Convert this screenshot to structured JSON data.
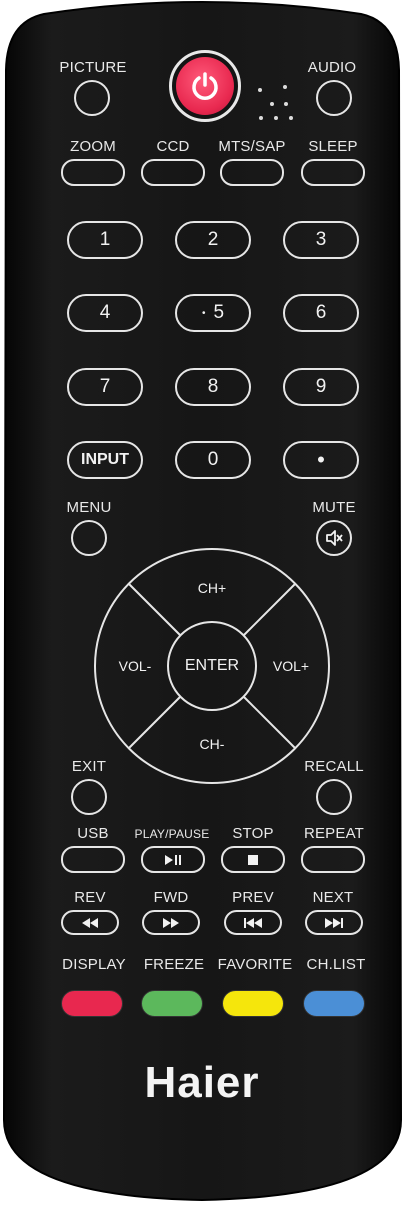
{
  "labels": {
    "picture": "PICTURE",
    "audio": "AUDIO",
    "zoom": "ZOOM",
    "ccd": "CCD",
    "mts_sap": "MTS/SAP",
    "sleep": "SLEEP",
    "menu": "MENU",
    "mute": "MUTE",
    "exit": "EXIT",
    "recall": "RECALL",
    "usb": "USB",
    "play_pause": "PLAY/PAUSE",
    "stop": "STOP",
    "repeat": "REPEAT",
    "rev": "REV",
    "fwd": "FWD",
    "prev": "PREV",
    "next": "NEXT",
    "display": "DISPLAY",
    "freeze": "FREEZE",
    "favorite": "FAVORITE",
    "ch_list": "CH.LIST"
  },
  "keypad": {
    "k1": "1",
    "k2": "2",
    "k3": "3",
    "k4": "4",
    "k5": "5",
    "k6": "6",
    "k7": "7",
    "k8": "8",
    "k9": "9",
    "input": "INPUT",
    "k0": "0",
    "dot": "•"
  },
  "dpad": {
    "up": "CH+",
    "down": "CH-",
    "left": "VOL-",
    "right": "VOL+",
    "center": "ENTER"
  },
  "brand": "Haier",
  "icons": {
    "power": "power-icon",
    "mute": "mute-speaker-icon",
    "play_pause": "play-pause-icon",
    "stop": "stop-icon",
    "rev": "rewind-icon",
    "fwd": "fast-forward-icon",
    "prev": "skip-previous-icon",
    "next": "skip-next-icon"
  },
  "colors": {
    "body": "#141414",
    "power_button": "#e8284f",
    "red": "#e8284f",
    "green": "#5cb85c",
    "yellow": "#f5e60c",
    "blue": "#4b8fd6"
  }
}
